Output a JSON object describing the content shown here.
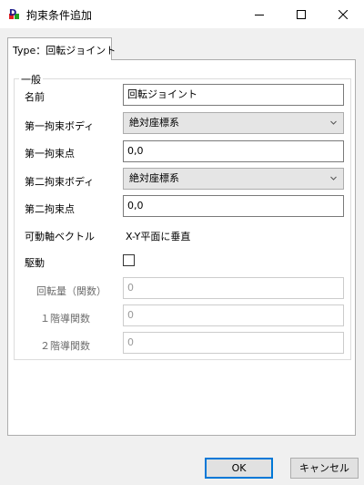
{
  "window": {
    "title": "拘束条件追加"
  },
  "tab": {
    "label": "Type：回転ジョイント"
  },
  "group": {
    "title": "一般"
  },
  "fields": {
    "name": {
      "label": "名前",
      "value": "回転ジョイント"
    },
    "body1": {
      "label": "第一拘束ボディ",
      "value": "絶対座標系"
    },
    "point1": {
      "label": "第一拘束点",
      "value": "0,0"
    },
    "body2": {
      "label": "第二拘束ボディ",
      "value": "絶対座標系"
    },
    "point2": {
      "label": "第二拘束点",
      "value": "0,0"
    },
    "axis": {
      "label": "可動軸ベクトル",
      "value": "X-Y平面に垂直"
    },
    "drive": {
      "label": "駆動",
      "checked": false
    },
    "rotation": {
      "label": "回転量（関数）",
      "value": "0"
    },
    "deriv1": {
      "label": "１階導関数",
      "value": "0"
    },
    "deriv2": {
      "label": "２階導関数",
      "value": "0"
    }
  },
  "buttons": {
    "ok": "OK",
    "cancel": "キャンセル"
  }
}
